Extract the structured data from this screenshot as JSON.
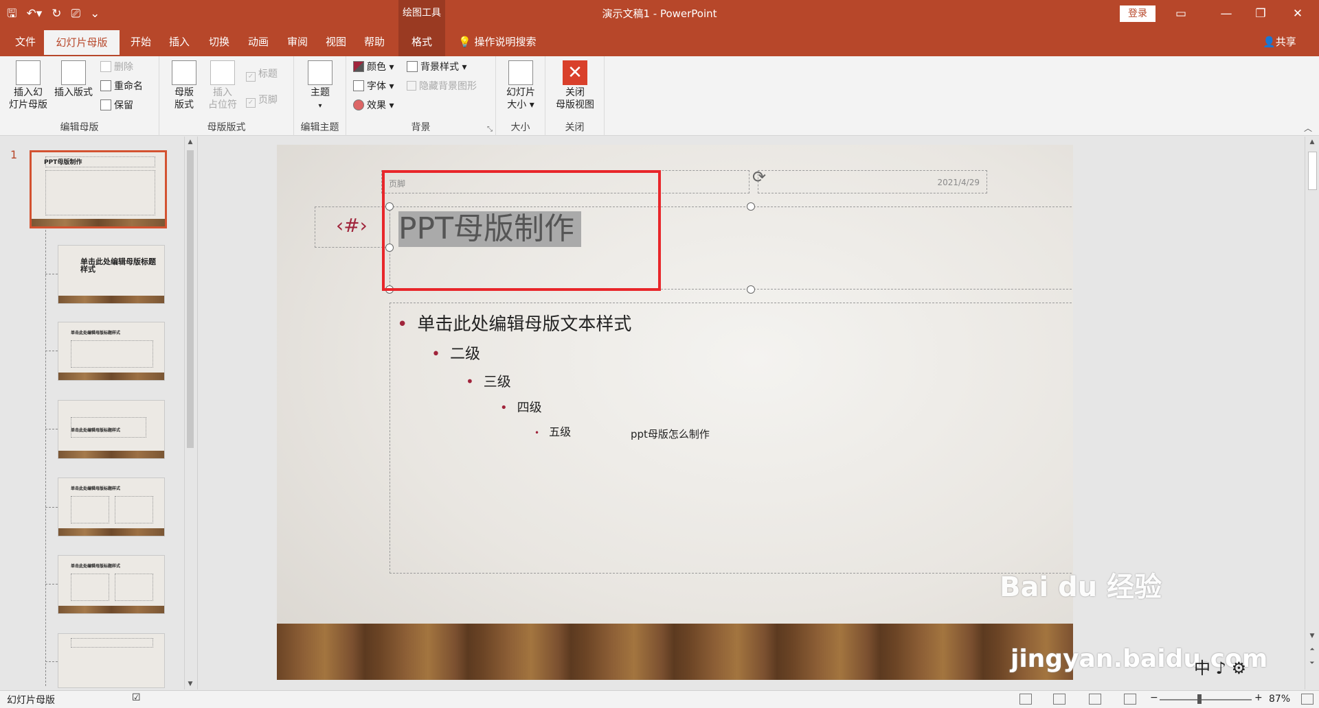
{
  "titlebar": {
    "context_tools": "绘图工具",
    "doc_title": "演示文稿1  -  PowerPoint",
    "login": "登录",
    "qat_icons": [
      "save-icon",
      "undo-icon",
      "redo-icon",
      "present-icon",
      "customize-icon"
    ]
  },
  "tabs": [
    {
      "label": "文件"
    },
    {
      "label": "幻灯片母版"
    },
    {
      "label": "开始"
    },
    {
      "label": "插入"
    },
    {
      "label": "切换"
    },
    {
      "label": "动画"
    },
    {
      "label": "审阅"
    },
    {
      "label": "视图"
    },
    {
      "label": "帮助"
    },
    {
      "label": "格式"
    }
  ],
  "tell_me": "操作说明搜索",
  "share": "共享",
  "ribbon": {
    "edit_master": {
      "label": "编辑母版",
      "insert_master": "插入幻\n灯片母版",
      "insert_layout": "插入版式",
      "delete": "删除",
      "rename": "重命名",
      "preserve": "保留"
    },
    "master_layout": {
      "label": "母版版式",
      "master_layout_btn": "母版\n版式",
      "insert_placeholder": "插入\n占位符",
      "title_chk": "标题",
      "footer_chk": "页脚"
    },
    "edit_theme": {
      "label": "编辑主题",
      "theme": "主题"
    },
    "background": {
      "label": "背景",
      "colors": "颜色",
      "fonts": "字体",
      "effects": "效果",
      "bg_styles": "背景样式",
      "hide_bg": "隐藏背景图形"
    },
    "size": {
      "label": "大小",
      "slide_size": "幻灯片\n大小"
    },
    "close": {
      "label": "关闭",
      "close_master": "关闭\n母版视图"
    }
  },
  "thumbnails": {
    "slide_number": "1",
    "items": [
      {
        "title": "PPT母版制作"
      },
      {
        "title": "单击此处编辑母版标题样式"
      },
      {
        "title": "单击此处编辑母版标题样式"
      },
      {
        "title": "单击此处编辑母版标题样式"
      },
      {
        "title": "单击此处编辑母版标题样式"
      },
      {
        "title": "单击此处编辑母版标题样式"
      },
      {
        "title": ""
      }
    ]
  },
  "slide": {
    "footer": "页脚",
    "date": "2021/4/29",
    "number": "‹#›",
    "title": "PPT母版制作",
    "bullets": [
      {
        "text": "单击此处编辑母版文本样式",
        "level": 1
      },
      {
        "text": "二级",
        "level": 2
      },
      {
        "text": "三级",
        "level": 3
      },
      {
        "text": "四级",
        "level": 4
      },
      {
        "text": "五级",
        "level": 5
      }
    ],
    "caption": "ppt母版怎么制作"
  },
  "status": {
    "view": "幻灯片母版",
    "zoom": "87%",
    "zoom_fraction": 0.41
  },
  "watermark": {
    "line1": "Bai du 经验",
    "line2": "jingyan.baidu.com"
  },
  "ime": "中 ♪ ⚙",
  "colors": {
    "accent": "#b7472a",
    "selection_box": "#e8262a",
    "bullet": "#a0243b"
  }
}
